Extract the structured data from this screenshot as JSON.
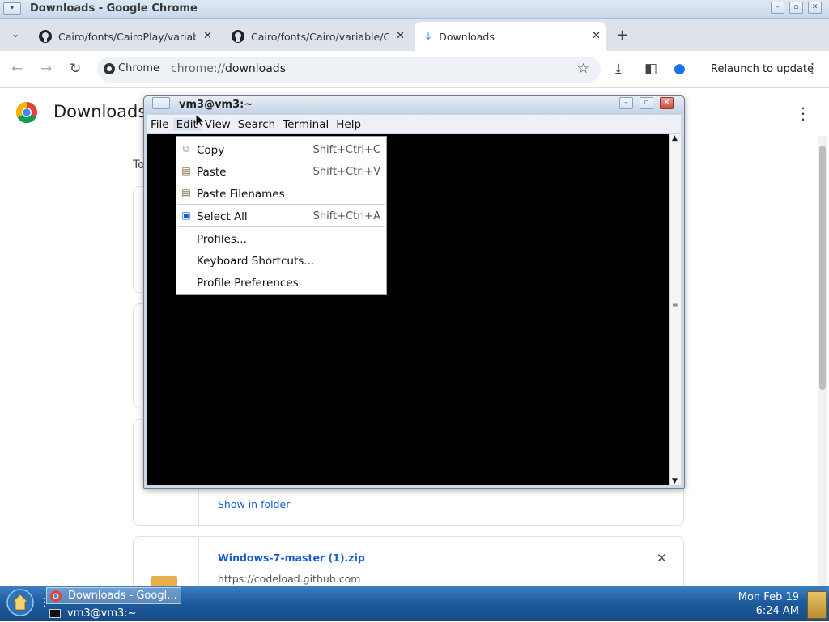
{
  "chrome": {
    "window_title": "Downloads - Google Chrome",
    "tabs": [
      {
        "label": "Cairo/fonts/CairoPlay/variable",
        "close": "✕"
      },
      {
        "label": "Cairo/fonts/Cairo/variable/Ca",
        "close": "✕"
      },
      {
        "label": "Downloads",
        "close": "✕"
      }
    ],
    "new_tab": "+",
    "omnibox": {
      "chip": "Chrome",
      "url_prefix": "chrome://",
      "url_path": "downloads"
    },
    "relaunch_label": "Relaunch to update"
  },
  "downloads_page": {
    "title": "Downloads",
    "today_label": "To",
    "show_in_folder": "Show in folder",
    "last_item": {
      "filename": "Windows-7-master (1).zip",
      "source": "https://codeload.github.com",
      "remove": "✕"
    }
  },
  "terminal": {
    "title": "vm3@vm3:~",
    "menus": [
      "File",
      "Edit",
      "View",
      "Search",
      "Terminal",
      "Help"
    ]
  },
  "edit_menu": {
    "items": [
      {
        "label": "Copy",
        "shortcut": "Shift+Ctrl+C"
      },
      {
        "label": "Paste",
        "shortcut": "Shift+Ctrl+V"
      },
      {
        "label": "Paste Filenames",
        "shortcut": ""
      },
      {
        "label": "Select All",
        "shortcut": "Shift+Ctrl+A"
      },
      {
        "label": "Profiles...",
        "shortcut": ""
      },
      {
        "label": "Keyboard Shortcuts...",
        "shortcut": ""
      },
      {
        "label": "Profile Preferences",
        "shortcut": ""
      }
    ]
  },
  "taskbar": {
    "tasks": [
      {
        "label": "Downloads - Googl..."
      },
      {
        "label": "vm3@vm3:~"
      }
    ],
    "clock": {
      "date": "Mon Feb 19",
      "time": "6:24 AM"
    }
  },
  "colors": {
    "accent": "#1a73e8",
    "taskbar": "#1e5c9e",
    "terminal_bg": "#000000"
  }
}
